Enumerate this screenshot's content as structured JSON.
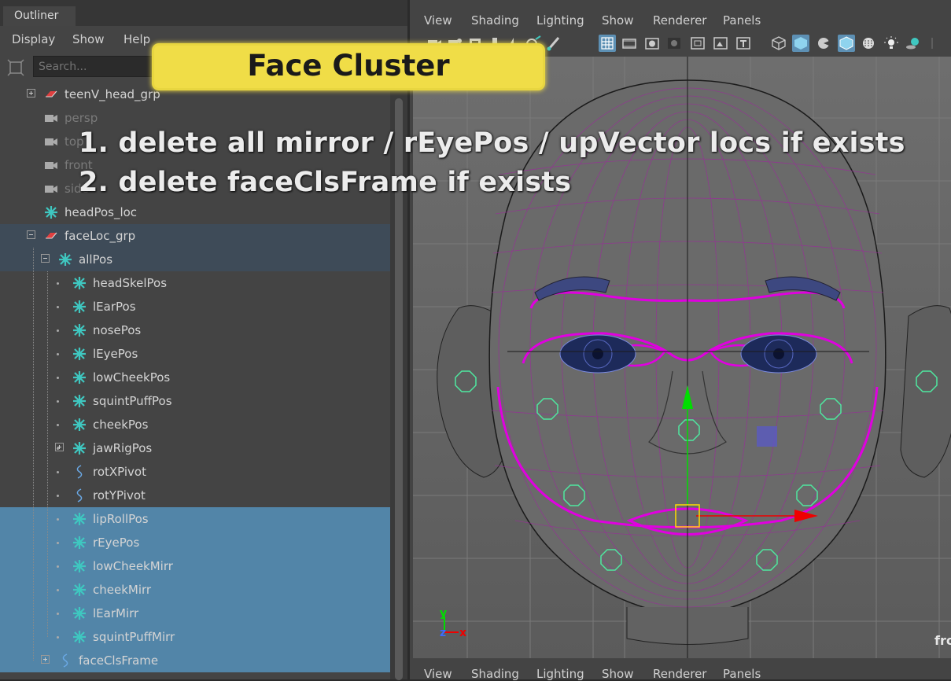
{
  "outliner": {
    "tab_label": "Outliner",
    "menu": [
      "Display",
      "Show",
      "Help"
    ],
    "search_placeholder": "Search...",
    "items": [
      {
        "label": "teenV_head_grp",
        "icon": "group-icon",
        "dim": false
      },
      {
        "label": "persp",
        "icon": "camera-icon",
        "dim": true
      },
      {
        "label": "top",
        "icon": "camera-icon",
        "dim": true
      },
      {
        "label": "front",
        "icon": "camera-icon",
        "dim": true
      },
      {
        "label": "side",
        "icon": "camera-icon",
        "dim": true
      },
      {
        "label": "headPos_loc",
        "icon": "locator-icon",
        "dim": false
      },
      {
        "label": "faceLoc_grp",
        "icon": "group-icon",
        "dim": false
      },
      {
        "label": "allPos",
        "icon": "locator-icon",
        "dim": false
      },
      {
        "label": "headSkelPos",
        "icon": "locator-icon",
        "dim": false
      },
      {
        "label": "lEarPos",
        "icon": "locator-icon",
        "dim": false
      },
      {
        "label": "nosePos",
        "icon": "locator-icon",
        "dim": false
      },
      {
        "label": "lEyePos",
        "icon": "locator-icon",
        "dim": false
      },
      {
        "label": "lowCheekPos",
        "icon": "locator-icon",
        "dim": false
      },
      {
        "label": "squintPuffPos",
        "icon": "locator-icon",
        "dim": false
      },
      {
        "label": "cheekPos",
        "icon": "locator-icon",
        "dim": false
      },
      {
        "label": "jawRigPos",
        "icon": "locator-icon",
        "dim": false
      },
      {
        "label": "rotXPivot",
        "icon": "curve-icon",
        "dim": false
      },
      {
        "label": "rotYPivot",
        "icon": "curve-icon",
        "dim": false
      },
      {
        "label": "lipRollPos",
        "icon": "locator-icon",
        "dim": false
      },
      {
        "label": "rEyePos",
        "icon": "locator-icon",
        "dim": false
      },
      {
        "label": "lowCheekMirr",
        "icon": "locator-icon",
        "dim": false
      },
      {
        "label": "cheekMirr",
        "icon": "locator-icon",
        "dim": false
      },
      {
        "label": "lEarMirr",
        "icon": "locator-icon",
        "dim": false
      },
      {
        "label": "squintPuffMirr",
        "icon": "locator-icon",
        "dim": false
      },
      {
        "label": "faceClsFrame",
        "icon": "curve-icon",
        "dim": false
      }
    ]
  },
  "viewport": {
    "menu": [
      "View",
      "Shading",
      "Lighting",
      "Show",
      "Renderer",
      "Panels"
    ],
    "panel_label": "fro",
    "axis_labels": {
      "y": "y",
      "z": "z",
      "x": "x"
    }
  },
  "overlay": {
    "title": "Face Cluster",
    "instructions": [
      "1. delete all mirror / rEyePos / upVector locs if exists",
      "2. delete faceClsFrame if exists"
    ]
  },
  "colors": {
    "selection_blue": "#5285a8",
    "selection_dark": "#3e4b58",
    "locator_teal": "#3fc7c0",
    "wire_magenta": "#e000e0",
    "banner_yellow": "#f0dd47",
    "manip_green": "#00dd00",
    "manip_red": "#ee0000"
  }
}
